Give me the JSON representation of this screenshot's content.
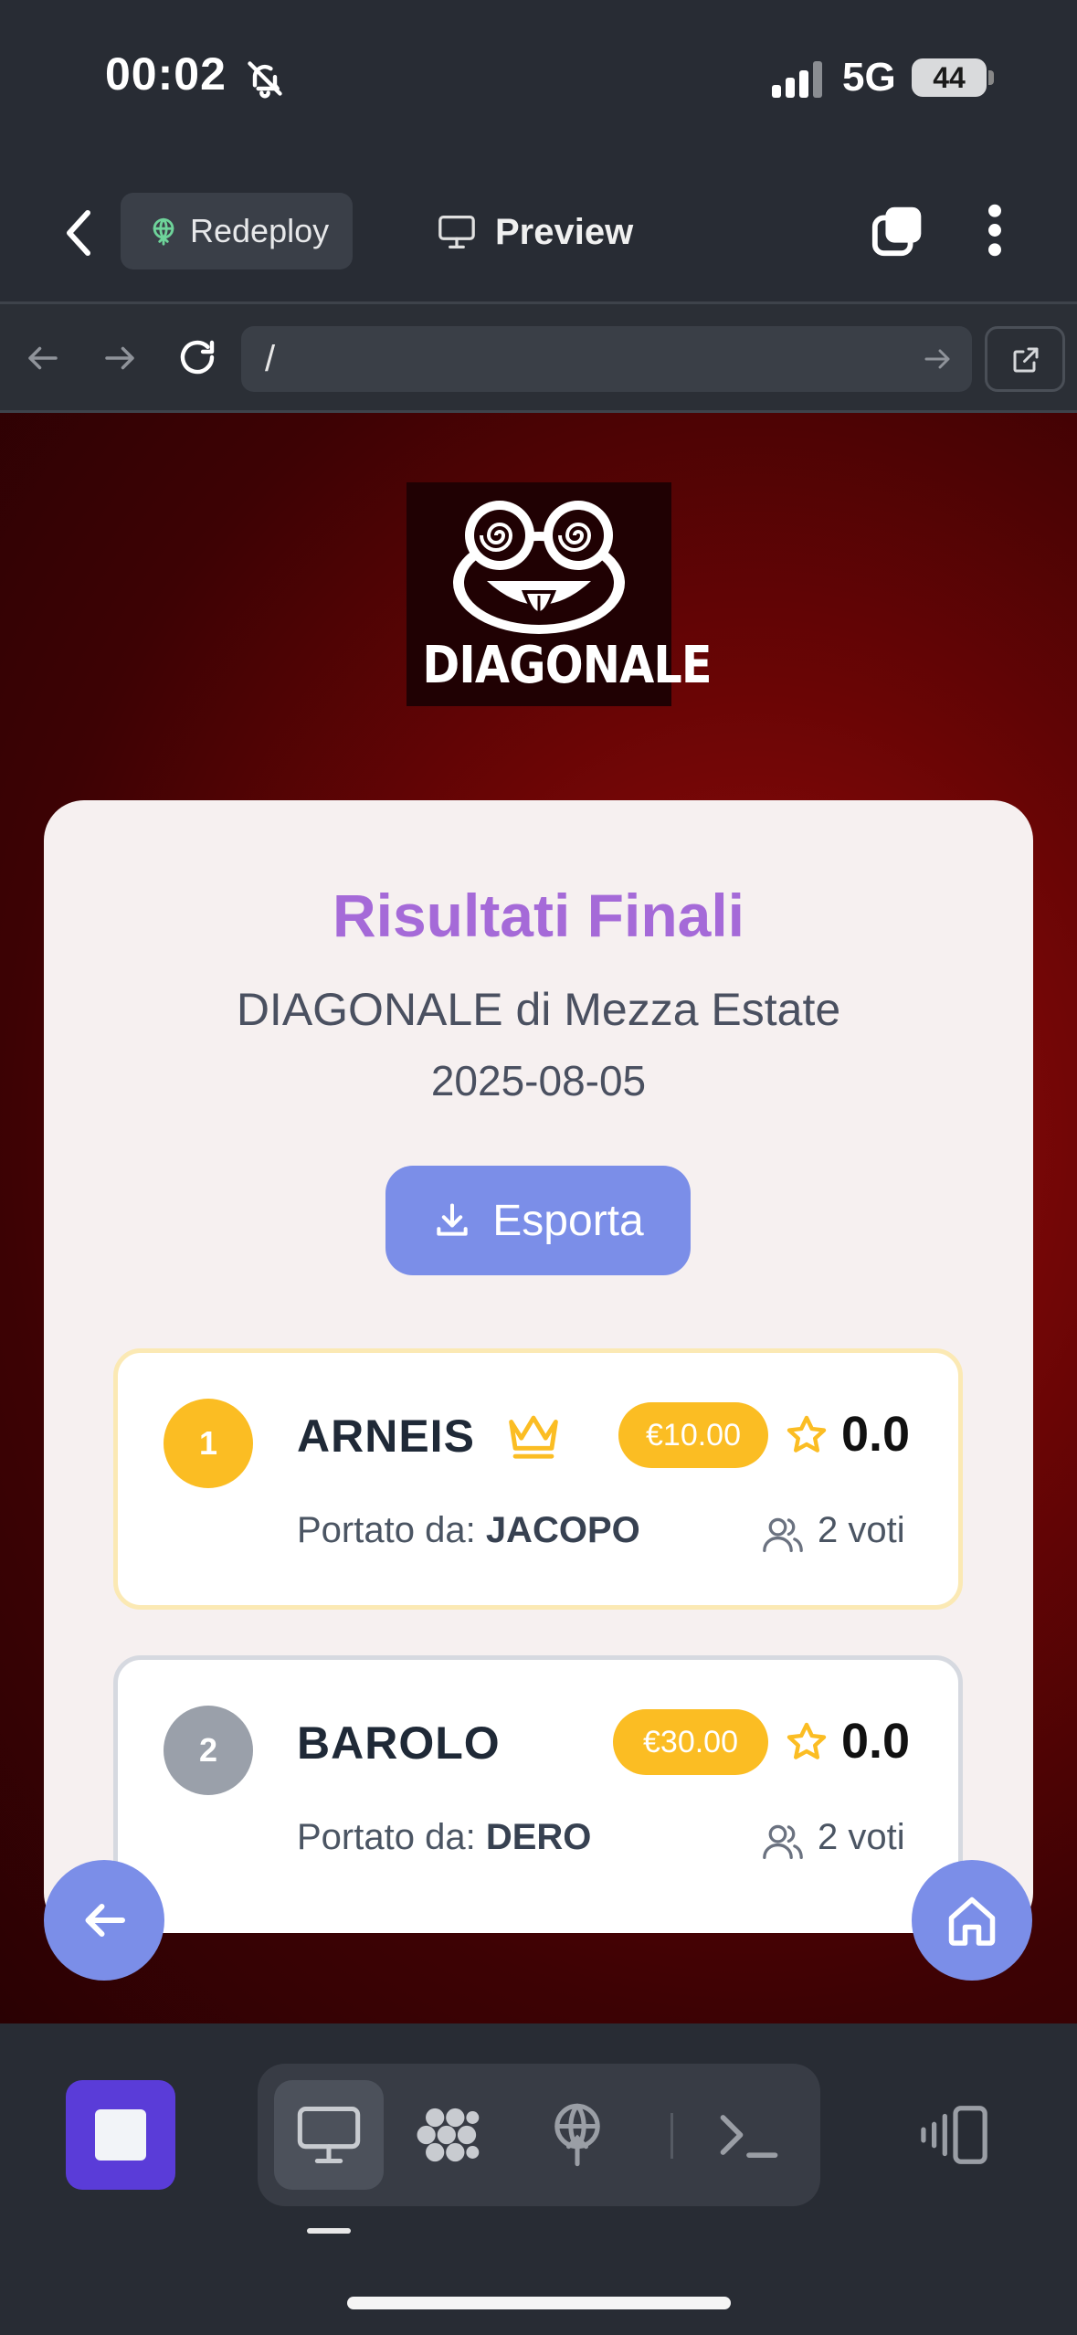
{
  "status_bar": {
    "time": "00:02",
    "network": "5G",
    "battery": "44"
  },
  "toolbar": {
    "redeploy_label": "Redeploy",
    "preview_label": "Preview"
  },
  "browser": {
    "url": "/"
  },
  "page": {
    "logo_text": "DIAGONALE",
    "title": "Risultati Finali",
    "event_name": "DIAGONALE di Mezza Estate",
    "date": "2025-08-05",
    "export_label": "Esporta",
    "results": [
      {
        "rank": "1",
        "name": "ARNEIS",
        "price": "€10.00",
        "score": "0.0",
        "brought_prefix": "Portato da:",
        "brought_by": "JACOPO",
        "votes": "2 voti"
      },
      {
        "rank": "2",
        "name": "BAROLO",
        "price": "€30.00",
        "score": "0.0",
        "brought_prefix": "Portato da:",
        "brought_by": "DERO",
        "votes": "2 voti"
      }
    ]
  },
  "colors": {
    "accent": "#7b8ee8",
    "title": "#a56ad8",
    "gold": "#fbbd23",
    "silver": "#9aa0aa",
    "stop": "#5a3cd8"
  }
}
